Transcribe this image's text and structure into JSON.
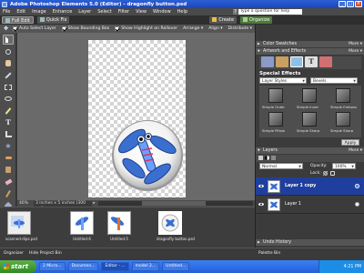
{
  "window": {
    "title": "Adobe Photoshop Elements 5.0 (Editor) - dragonfly button.psd"
  },
  "menu": {
    "items": [
      "File",
      "Edit",
      "Image",
      "Enhance",
      "Layer",
      "Select",
      "Filter",
      "View",
      "Window",
      "Help"
    ],
    "help_placeholder": "Type a question for help",
    "help_button": "?"
  },
  "modes": {
    "full_edit": "Full Edit",
    "quick_fix": "Quick Fix",
    "create": "Create",
    "organize": "Organize"
  },
  "options": {
    "auto_select_layer": "Auto Select Layer",
    "show_bounding_box": "Show Bounding Box",
    "show_highlight": "Show Highlight on Rollover",
    "arrange": "Arrange",
    "align": "Align",
    "distribute": "Distribute"
  },
  "status": {
    "zoom": "46%",
    "doc_size": "3 inches x 5 inches (300 ppi)"
  },
  "project_bin": {
    "items": [
      {
        "caption": "scanned-dips.psd",
        "selected": false
      },
      {
        "caption": "Untitled-6",
        "selected": false
      },
      {
        "caption": "Untitled-5",
        "selected": false
      },
      {
        "caption": "dragonfly button.psd",
        "selected": true
      }
    ]
  },
  "panels": {
    "color_swatches": "Color Swatches",
    "artwork_effects": "Artwork and Effects",
    "special_effects_title": "Special Effects",
    "effects_dropdown": "Layer Styles",
    "bevels_dropdown": "Bevels",
    "styles": [
      {
        "name": "Simple Outer"
      },
      {
        "name": "Simple Inner"
      },
      {
        "name": "Simple Emboss"
      },
      {
        "name": "Simple Pillow"
      },
      {
        "name": "Simple Sharp"
      },
      {
        "name": "Simple Sharp"
      }
    ],
    "apply_button": "Apply",
    "layers_title": "Layers",
    "blend_mode": "Normal",
    "opacity_label": "Opacity:",
    "opacity_value": "100%",
    "lock_label": "Lock:",
    "layers": [
      {
        "name": "Layer 1 copy",
        "selected": true
      },
      {
        "name": "Layer 1",
        "selected": false
      }
    ],
    "undo_history": "Undo History"
  },
  "bottom": {
    "organizer": "Organizer",
    "hide_bin": "Hide Project Bin",
    "palette_bin": "Palette Bin"
  },
  "taskbar": {
    "start": "start",
    "tasks": [
      "2 Micro...",
      "Documen...",
      "Editor - ...",
      "model 2...",
      "Untitled..."
    ],
    "clock": "4:21 PM"
  }
}
